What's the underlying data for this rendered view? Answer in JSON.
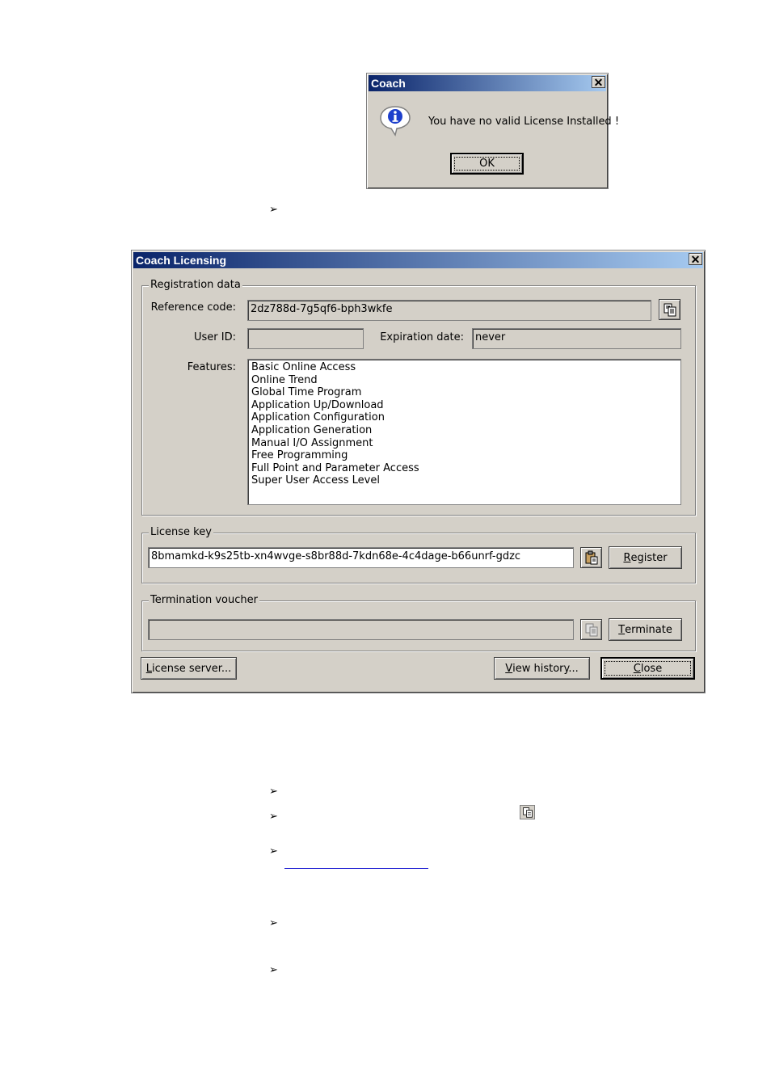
{
  "message_box": {
    "title": "Coach",
    "message": "You have no valid License Installed !",
    "ok_label": "OK"
  },
  "bullets": [
    "➢",
    "➢",
    "➢",
    "➢",
    "➢",
    "➢"
  ],
  "licensing": {
    "title": "Coach Licensing",
    "registration": {
      "group_label": "Registration data",
      "reference_label": "Reference code:",
      "reference_value": "2dz788d-7g5qf6-bph3wkfe",
      "userid_label": "User ID:",
      "userid_value": "",
      "expiration_label": "Expiration date:",
      "expiration_value": "never",
      "features_label": "Features:",
      "features": [
        "Basic Online Access",
        "Online Trend",
        "Global Time Program",
        "Application Up/Download",
        "Application Configuration",
        "Application Generation",
        "Manual I/O Assignment",
        "Free Programming",
        "Full Point and Parameter Access",
        "Super User Access Level"
      ]
    },
    "license_key": {
      "group_label": "License key",
      "value": "8bmamkd-k9s25tb-xn4wvge-s8br88d-7kdn68e-4c4dage-b66unrf-gdzc",
      "register_label_ul": "R",
      "register_label_rest": "egister"
    },
    "termination": {
      "group_label": "Termination voucher",
      "value": "",
      "terminate_label_ul": "T",
      "terminate_label_rest": "erminate"
    },
    "buttons": {
      "license_server_ul": "L",
      "license_server_rest": "icense server...",
      "view_history_ul": "V",
      "view_history_rest": "iew history...",
      "close_ul": "C",
      "close_rest": "lose"
    }
  }
}
